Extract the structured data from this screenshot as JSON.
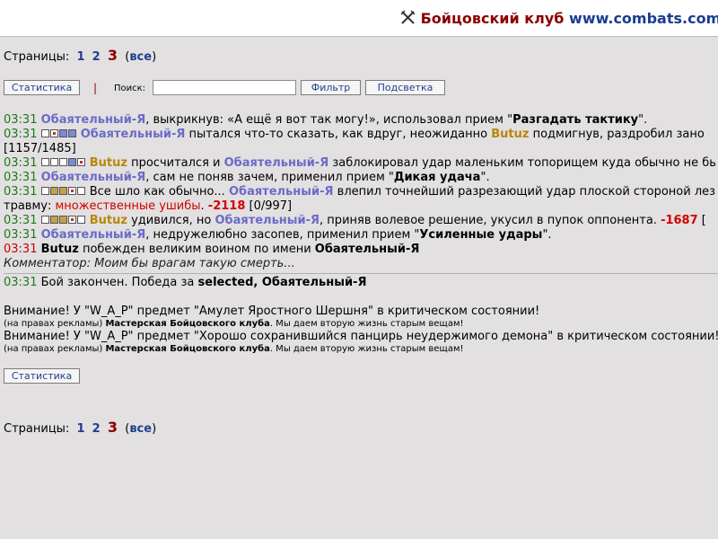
{
  "header": {
    "club_name": "Бойцовский клуб",
    "url": "www.combats.com"
  },
  "pagination": {
    "label": "Страницы:",
    "pages": [
      "1",
      "2"
    ],
    "current": "3",
    "all": "все"
  },
  "toolbar": {
    "stats_label": "Статистика",
    "separator": "|",
    "search_label": "Поиск:",
    "search_value": "",
    "filter_label": "Фильтр",
    "highlight_label": "Подсветка"
  },
  "log": {
    "l1": {
      "time": "03:31",
      "p1": "Обаятельный-Я",
      "t1": ", выкрикнув: «А ещё я вот так могу!», использовал прием \"",
      "skill": "Разгадать тактику",
      "t2": "\"."
    },
    "l2": {
      "time": "03:31",
      "p1": "Обаятельный-Я",
      "t1": " пытался что-то сказать, как вдруг, неожиданно ",
      "p2": "Butuz",
      "t2": " подмигнув, раздробил зано"
    },
    "l2b": {
      "text": "[1157/1485]"
    },
    "l3": {
      "time": "03:31",
      "p1": "Butuz",
      "t1": " просчитался и ",
      "p2": "Обаятельный-Я",
      "t2": " заблокировал удар маленьким топорищем куда обычно не бь"
    },
    "l4": {
      "time": "03:31",
      "p1": "Обаятельный-Я",
      "t1": ", сам не поняв зачем, применил прием \"",
      "skill": "Дикая удача",
      "t2": "\"."
    },
    "l5": {
      "time": "03:31",
      "t1": " Все шло как обычно... ",
      "p1": "Обаятельный-Я",
      "t2": " влепил точнейший разрезающий удар плоской стороной лез"
    },
    "l5b": {
      "t1": "травму: ",
      "effect": "множественные ушибы",
      "t2": ". ",
      "dmg": "-2118",
      "hp": " [0/997]"
    },
    "l6": {
      "time": "03:31",
      "p1": "Butuz",
      "t1": " удивился, но ",
      "p2": "Обаятельный-Я",
      "t2": ", приняв волевое решение, укусил в пупок оппонента. ",
      "dmg": "-1687",
      "t3": " ["
    },
    "l7": {
      "time": "03:31",
      "p1": "Обаятельный-Я",
      "t1": ", недружелюбно засопев, применил прием \"",
      "skill": "Усиленные удары",
      "t2": "\"."
    },
    "l8": {
      "time": "03:31",
      "p1": "Butuz",
      "t1": " побежден великим воином по имени ",
      "p2": "Обаятельный-Я"
    },
    "comment": "Комментатор: Моим бы врагам такую смерть...",
    "end": {
      "time": "03:31",
      "t1": " Бой закончен. Победа за ",
      "winner": "selected, Обаятельный-Я"
    }
  },
  "warnings": [
    {
      "text": "Внимание! У \"W_A_P\" предмет \"Амулет Яростного Шершня\" в критическом состоянии!",
      "ad_pre": "(на правах рекламы) ",
      "ad_shop": "Мастерская Бойцовского клуба",
      "ad_post": ". Мы даем вторую жизнь старым вещам!"
    },
    {
      "text": "Внимание! У \"W_A_P\" предмет \"Хорошо сохранившийся панцирь неудержимого демона\" в критическом состоянии!",
      "ad_pre": "(на правах рекламы) ",
      "ad_shop": "Мастерская Бойцовского клуба",
      "ad_post": ". Мы даем вторую жизнь старым вещам!"
    }
  ],
  "bottom": {
    "stats_label": "Статистика"
  },
  "colors": {
    "background": "#e2e0e0",
    "player_blue": "#6b6bc8",
    "player_brown": "#b8860b",
    "damage": "#d40000",
    "time_green": "#1b7a1b",
    "time_red": "#cc0000"
  }
}
